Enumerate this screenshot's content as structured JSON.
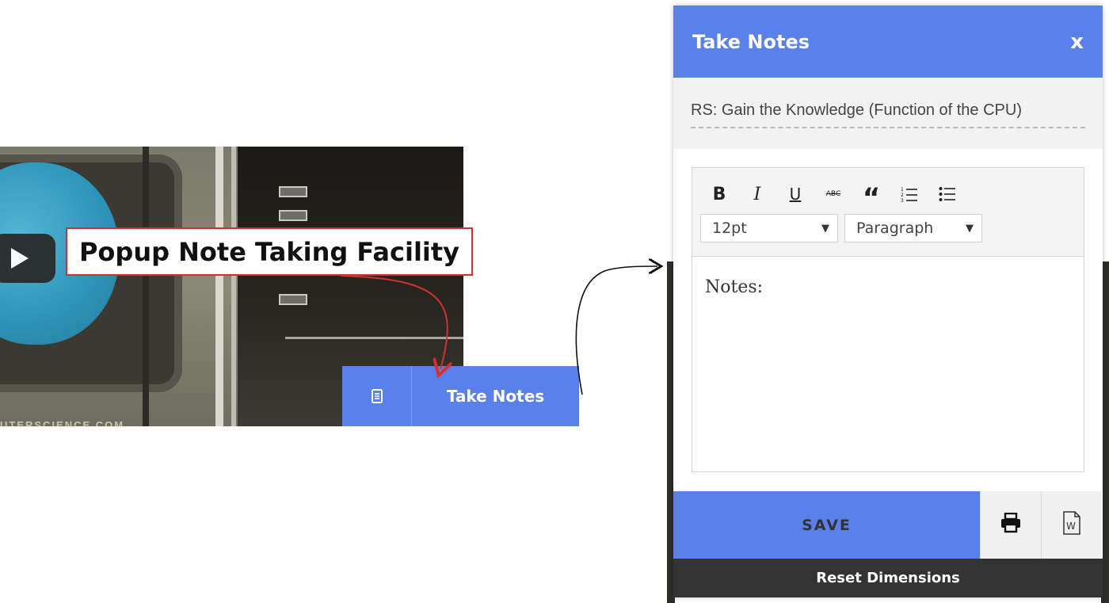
{
  "callout": {
    "text": "Popup Note Taking Facility"
  },
  "video": {
    "play_icon": "play-icon",
    "watermark": "UTERSCIENCE.COM"
  },
  "tab_button": {
    "icon": "document-icon",
    "label": "Take Notes"
  },
  "modal": {
    "title": "Take Notes",
    "close_label": "x",
    "note_title_value": "RS: Gain the Knowledge (Function of the CPU)",
    "toolbar": {
      "bold": "B",
      "italic": "I",
      "underline": "U",
      "strike": "ABC",
      "quote": "“",
      "font_size": "12pt",
      "block_format": "Paragraph"
    },
    "notes_text": "Notes:",
    "save_label": "SAVE",
    "print_icon": "print-icon",
    "word_icon": "word-doc-icon",
    "reset_label": "Reset Dimensions"
  },
  "colors": {
    "accent": "#5a80ea",
    "callout_border": "#d1312f",
    "footer_dark": "#333333"
  }
}
